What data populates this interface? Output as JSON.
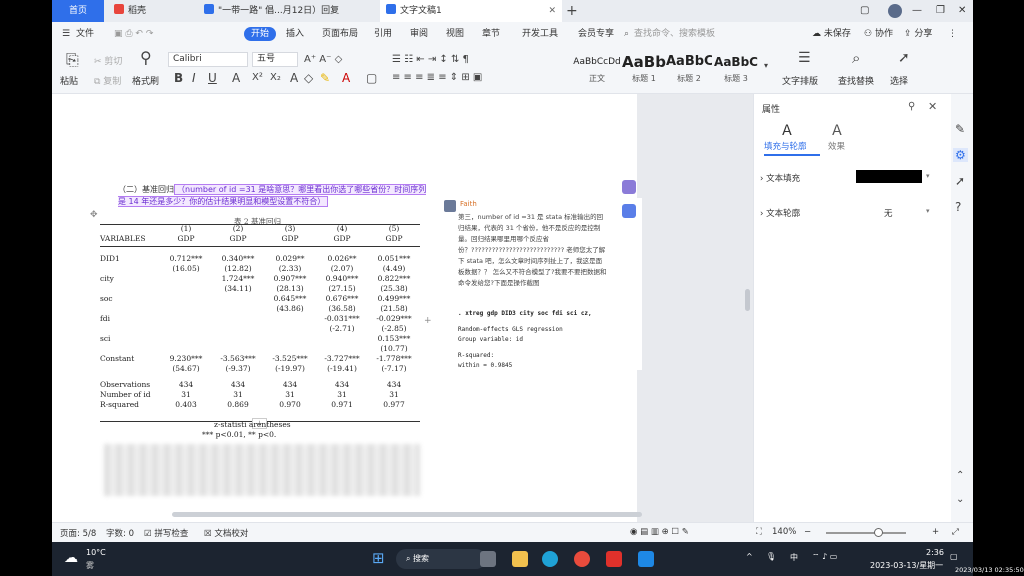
{
  "tabs": {
    "home": "首页",
    "daoke": "稻壳",
    "doc2": "\"一带一路\" 倡...月12日）回复",
    "doc3": "文字文稿1",
    "new_tab": "+"
  },
  "menu": {
    "file": "文件",
    "start": "开始",
    "insert": "插入",
    "layout": "页面布局",
    "reference": "引用",
    "review": "审阅",
    "view": "视图",
    "chapter": "章节",
    "developer": "开发工具",
    "member": "会员专享",
    "search_placeholder": "查找命令、搜索模板",
    "unsaved": "未保存",
    "collab": "协作",
    "share": "分享"
  },
  "ribbon": {
    "paste": "粘贴",
    "cut": "剪切",
    "copy": "复制",
    "format_painter": "格式刷",
    "font_name": "Calibri",
    "font_size": "五号",
    "style_normal_preview": "AaBbCcDd",
    "style_normal": "正文",
    "style_h1_preview": "AaBb",
    "style_h1": "标题 1",
    "style_h2_preview": "AaBbC",
    "style_h2": "标题 2",
    "style_h3_preview": "AaBbC",
    "style_h3": "标题 3",
    "text_layout": "文字排版",
    "find_replace": "查找替换",
    "select": "选择"
  },
  "document": {
    "heading": "（二）基准回归",
    "comment_highlight": "（number of id =31 是啥意思？哪里看出你选了哪些省份？时间序列是 14 年还是多少？你的估计结果明显和模型设置不符合）",
    "table_title": "表 2 基准回归",
    "col_numbers": [
      "(1)",
      "(2)",
      "(3)",
      "(4)",
      "(5)"
    ],
    "col_header": "VARIABLES",
    "col_names": [
      "GDP",
      "GDP",
      "GDP",
      "GDP",
      "GDP"
    ],
    "rows": [
      {
        "var": "DID1",
        "vals": [
          "0.712***",
          "0.340***",
          "0.029**",
          "0.026**",
          "0.051***"
        ]
      },
      {
        "var": "",
        "vals": [
          "(16.05)",
          "(12.82)",
          "(2.33)",
          "(2.07)",
          "(4.49)"
        ]
      },
      {
        "var": "city",
        "vals": [
          "",
          "1.724***",
          "0.907***",
          "0.940***",
          "0.822***"
        ]
      },
      {
        "var": "",
        "vals": [
          "",
          "(34.11)",
          "(28.13)",
          "(27.15)",
          "(25.38)"
        ]
      },
      {
        "var": "soc",
        "vals": [
          "",
          "",
          "0.645***",
          "0.676***",
          "0.499***"
        ]
      },
      {
        "var": "",
        "vals": [
          "",
          "",
          "(43.86)",
          "(36.58)",
          "(21.58)"
        ]
      },
      {
        "var": "fdi",
        "vals": [
          "",
          "",
          "",
          "-0.031***",
          "-0.029***"
        ]
      },
      {
        "var": "",
        "vals": [
          "",
          "",
          "",
          "(-2.71)",
          "(-2.85)"
        ]
      },
      {
        "var": "sci",
        "vals": [
          "",
          "",
          "",
          "",
          "0.153***"
        ]
      },
      {
        "var": "",
        "vals": [
          "",
          "",
          "",
          "",
          "(10.77)"
        ]
      },
      {
        "var": "Constant",
        "vals": [
          "9.230***",
          "-3.563***",
          "-3.525***",
          "-3.727***",
          "-1.778***"
        ]
      },
      {
        "var": "",
        "vals": [
          "(54.67)",
          "(-9.37)",
          "(-19.97)",
          "(-19.41)",
          "(-7.17)"
        ]
      }
    ],
    "stats": [
      {
        "var": "Observations",
        "vals": [
          "434",
          "434",
          "434",
          "434",
          "434"
        ]
      },
      {
        "var": "Number of id",
        "vals": [
          "31",
          "31",
          "31",
          "31",
          "31"
        ]
      },
      {
        "var": "R-squared",
        "vals": [
          "0.403",
          "0.869",
          "0.970",
          "0.971",
          "0.977"
        ]
      }
    ],
    "note1": "z-statisti   arentheses",
    "note2": "*** p<0.01, ** p<0."
  },
  "comment": {
    "author": "Faith",
    "text": "第三，number of id =31 是 stata 标准输出的回归结果，代表的 31 个省份，他不是反应的是控制量。回归结果哪里用哪个反应省份？??????????????????????????? 老师您太了解下 stata 吧，怎么文章时间序列扯上了，我这是面板数据？？ 怎么又不符合模型了?我要不要把数据和命令发给您?下面是操作截图",
    "code1": ". xtreg gdp  DID3  city soc fdi  sci cz,",
    "code2": "Random-effects GLS regression",
    "code3": "Group variable: id",
    "code4": "R-squared:",
    "code5": "     within  = 0.9845"
  },
  "properties": {
    "title": "属性",
    "tab_fill": "填充与轮廓",
    "tab_effect": "效果",
    "text_fill": "文本填充",
    "text_outline": "文本轮廓",
    "outline_value": "无"
  },
  "status": {
    "page": "页面: 5/8",
    "words": "字数: 0",
    "spell": "拼写检查",
    "proof": "文档校对",
    "zoom": "140%"
  },
  "taskbar": {
    "weather_temp": "10°C",
    "weather_desc": "雾",
    "search": "搜索",
    "ime": "中",
    "time": "2:36",
    "date": "2023-03-13/星期一",
    "watermark": "2023/03/13 02:35:50"
  },
  "colors": {
    "accent": "#2f6fea",
    "comment_border": "#b57cf2",
    "author": "#d8732a"
  }
}
